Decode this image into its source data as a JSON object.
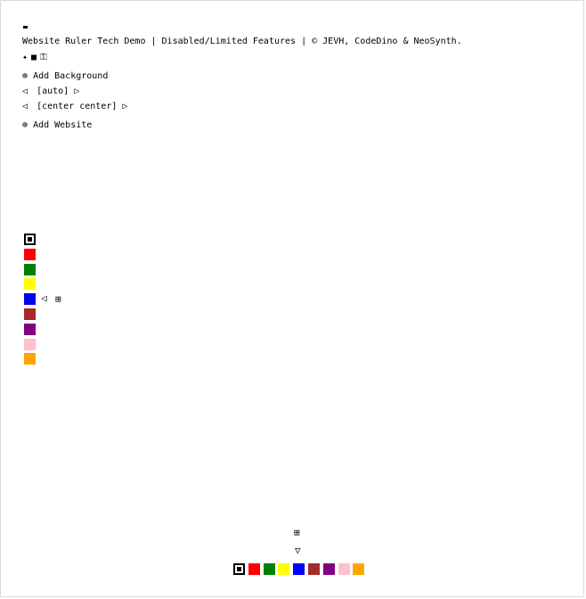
{
  "header": {
    "title": "Website Ruler Tech Demo | Disabled/Limited Features | © JEVH, CodeDino & NeoSynth."
  },
  "toolbar": {
    "icons": [
      "sparkle-icon",
      "square-icon",
      "key-box-icon"
    ],
    "sparkle": "✦",
    "square": "■",
    "key": "⚿"
  },
  "background": {
    "add_label": "Add Background",
    "add_icon": "⊕",
    "size_value": "[auto]",
    "position_value": "[center center]",
    "prev_arrow": "◁",
    "next_arrow": "▷"
  },
  "website": {
    "add_label": "Add Website",
    "add_icon": "⊕"
  },
  "side_palette": {
    "colors": [
      "#ffffff",
      "#ff0000",
      "#008000",
      "#ffff00",
      "#0000ff",
      "#a52a2a",
      "#800080",
      "#ffc0cb",
      "#ffa500"
    ],
    "selected_index": 0,
    "collapse_arrow": "◁",
    "grid_icon": "⊞"
  },
  "bottom_palette": {
    "colors": [
      "#ffffff",
      "#ff0000",
      "#008000",
      "#ffff00",
      "#0000ff",
      "#a52a2a",
      "#800080",
      "#ffc0cb",
      "#ffa500"
    ],
    "selected_index": 0,
    "grid_icon": "⊞",
    "collapse_arrow": "▽"
  }
}
